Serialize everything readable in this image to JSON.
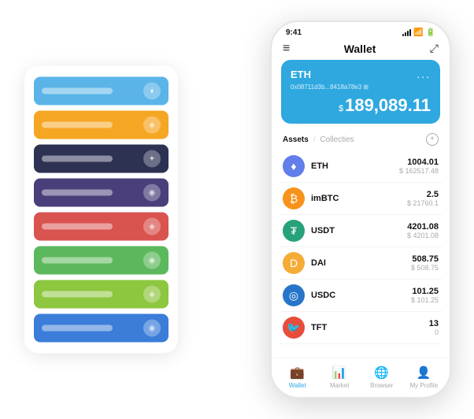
{
  "scene": {
    "background": "#ffffff"
  },
  "card_stack": {
    "cards": [
      {
        "color": "#5ab4e8",
        "label": "",
        "icon": "♦"
      },
      {
        "color": "#f5a623",
        "label": "",
        "icon": "◈"
      },
      {
        "color": "#2d3152",
        "label": "",
        "icon": "✦"
      },
      {
        "color": "#4a3f7a",
        "label": "",
        "icon": "◉"
      },
      {
        "color": "#d9534f",
        "label": "",
        "icon": "◈"
      },
      {
        "color": "#5cb85c",
        "label": "",
        "icon": "◉"
      },
      {
        "color": "#8dc63f",
        "label": "",
        "icon": "◈"
      },
      {
        "color": "#3b7dd8",
        "label": "",
        "icon": "◉"
      }
    ]
  },
  "phone": {
    "status_bar": {
      "time": "9:41",
      "signal": "●●●",
      "wifi": "wifi",
      "battery": "battery"
    },
    "top_nav": {
      "menu_icon": "≡",
      "title": "Wallet",
      "expand_icon": "⤢"
    },
    "eth_card": {
      "name": "ETH",
      "address": "0x08711d3b...8418a78e3  ⊞",
      "dots": "...",
      "currency_symbol": "$",
      "balance": "189,089.11"
    },
    "assets_header": {
      "tab_active": "Assets",
      "separator": "/",
      "tab_inactive": "Collecties",
      "add_icon": "+"
    },
    "assets": [
      {
        "name": "ETH",
        "icon_color": "#627EEA",
        "icon": "♦",
        "amount": "1004.01",
        "usd": "$ 162517.48"
      },
      {
        "name": "imBTC",
        "icon_color": "#f7931a",
        "icon": "₿",
        "amount": "2.5",
        "usd": "$ 21760.1"
      },
      {
        "name": "USDT",
        "icon_color": "#26A17B",
        "icon": "₮",
        "amount": "4201.08",
        "usd": "$ 4201.08"
      },
      {
        "name": "DAI",
        "icon_color": "#F5AC37",
        "icon": "◈",
        "amount": "508.75",
        "usd": "$ 508.75"
      },
      {
        "name": "USDC",
        "icon_color": "#2775CA",
        "icon": "◎",
        "amount": "101.25",
        "usd": "$ 101.25"
      },
      {
        "name": "TFT",
        "icon_color": "#e74c3c",
        "icon": "🐦",
        "amount": "13",
        "usd": "0"
      }
    ],
    "bottom_nav": [
      {
        "icon": "💼",
        "label": "Wallet",
        "active": true
      },
      {
        "icon": "📈",
        "label": "Market",
        "active": false
      },
      {
        "icon": "🌐",
        "label": "Browser",
        "active": false
      },
      {
        "icon": "👤",
        "label": "My Profile",
        "active": false
      }
    ]
  }
}
